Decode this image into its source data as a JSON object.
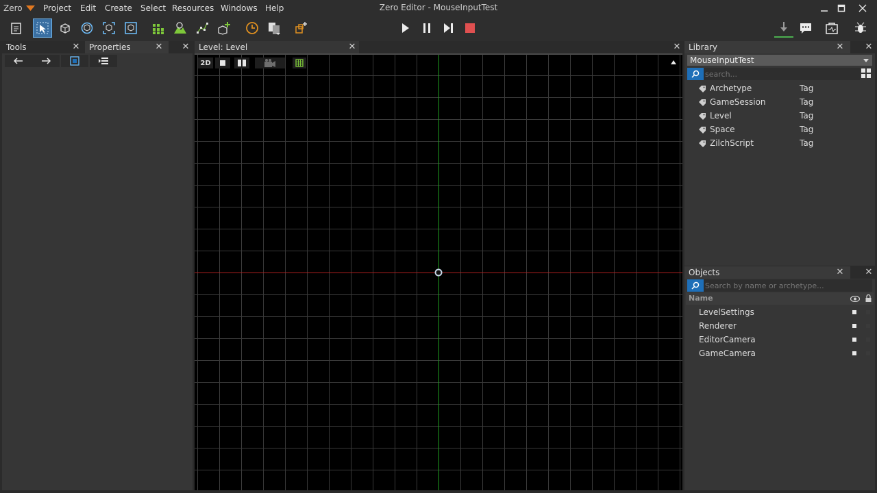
{
  "menu": {
    "app": "Zero",
    "items": [
      "Project",
      "Edit",
      "Create",
      "Select",
      "Resources",
      "Windows",
      "Help"
    ]
  },
  "window_title": "Zero Editor - MouseInputTest",
  "colors": {
    "accent_blue": "#3a6fa2",
    "grid_x_axis": "#b02020",
    "grid_y_axis": "#20a020",
    "stop_red": "#e05050",
    "icon_green": "#7ec83a",
    "icon_orange": "#e09020"
  },
  "left_panel": {
    "tabs": [
      "Tools",
      "Properties"
    ]
  },
  "viewport": {
    "tab_label": "Level: Level",
    "mode_label": "2D"
  },
  "library": {
    "title": "Library",
    "project": "MouseInputTest",
    "search_placeholder": "search...",
    "items": [
      {
        "name": "Archetype",
        "type": "Tag"
      },
      {
        "name": "GameSession",
        "type": "Tag"
      },
      {
        "name": "Level",
        "type": "Tag"
      },
      {
        "name": "Space",
        "type": "Tag"
      },
      {
        "name": "ZilchScript",
        "type": "Tag"
      }
    ]
  },
  "objects": {
    "title": "Objects",
    "search_placeholder": "Search by name or archetype...",
    "column_name": "Name",
    "items": [
      "LevelSettings",
      "Renderer",
      "EditorCamera",
      "GameCamera"
    ]
  }
}
